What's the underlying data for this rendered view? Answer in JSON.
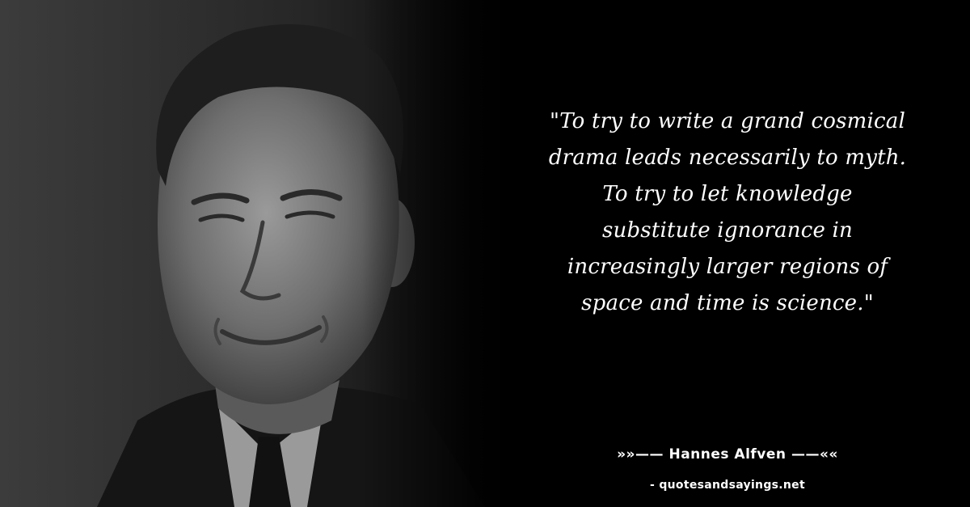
{
  "quote": {
    "lines": [
      "\"To try to write a grand cosmical",
      "drama leads necessarily to myth.",
      "To try to let knowledge",
      "substitute ignorance in",
      "increasingly larger regions of",
      "space and time is science.\""
    ]
  },
  "attribution": {
    "text": "»»—— Hannes Alfven ——««"
  },
  "source": {
    "text": "- quotesandsayings.net"
  },
  "photo": {
    "description_icon": "portrait-photo-icon",
    "palette": {
      "background": "#000000",
      "skin_light": "#8a8a8a",
      "skin_mid": "#5e5e5e",
      "hair": "#1c1c1c",
      "suit": "#141414",
      "shirt": "#9c9c9c"
    }
  }
}
